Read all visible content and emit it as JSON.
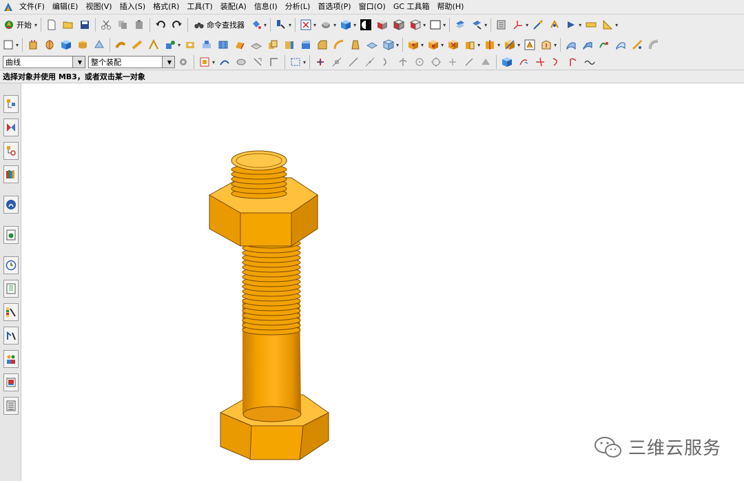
{
  "menu": {
    "items": [
      "文件(F)",
      "编辑(E)",
      "视图(V)",
      "插入(S)",
      "格式(R)",
      "工具(T)",
      "装配(A)",
      "信息(I)",
      "分析(L)",
      "首选项(P)",
      "窗口(O)",
      "GC 工具箱",
      "帮助(H)"
    ]
  },
  "toolbar": {
    "start_label": "开始",
    "command_finder_label": "命令查找器"
  },
  "selection_bar": {
    "type_filter": "曲线",
    "scope_filter": "整个装配"
  },
  "status": {
    "prompt": "选择对象并使用 MB3，或者双击某一对象"
  },
  "model": {
    "name": "bolt-and-nut",
    "color": "#f5a300"
  },
  "watermark": {
    "text": "三维云服务"
  },
  "colors": {
    "chrome": "#ececec",
    "accent": "#f5a300",
    "accent_dark": "#cc7e00"
  }
}
